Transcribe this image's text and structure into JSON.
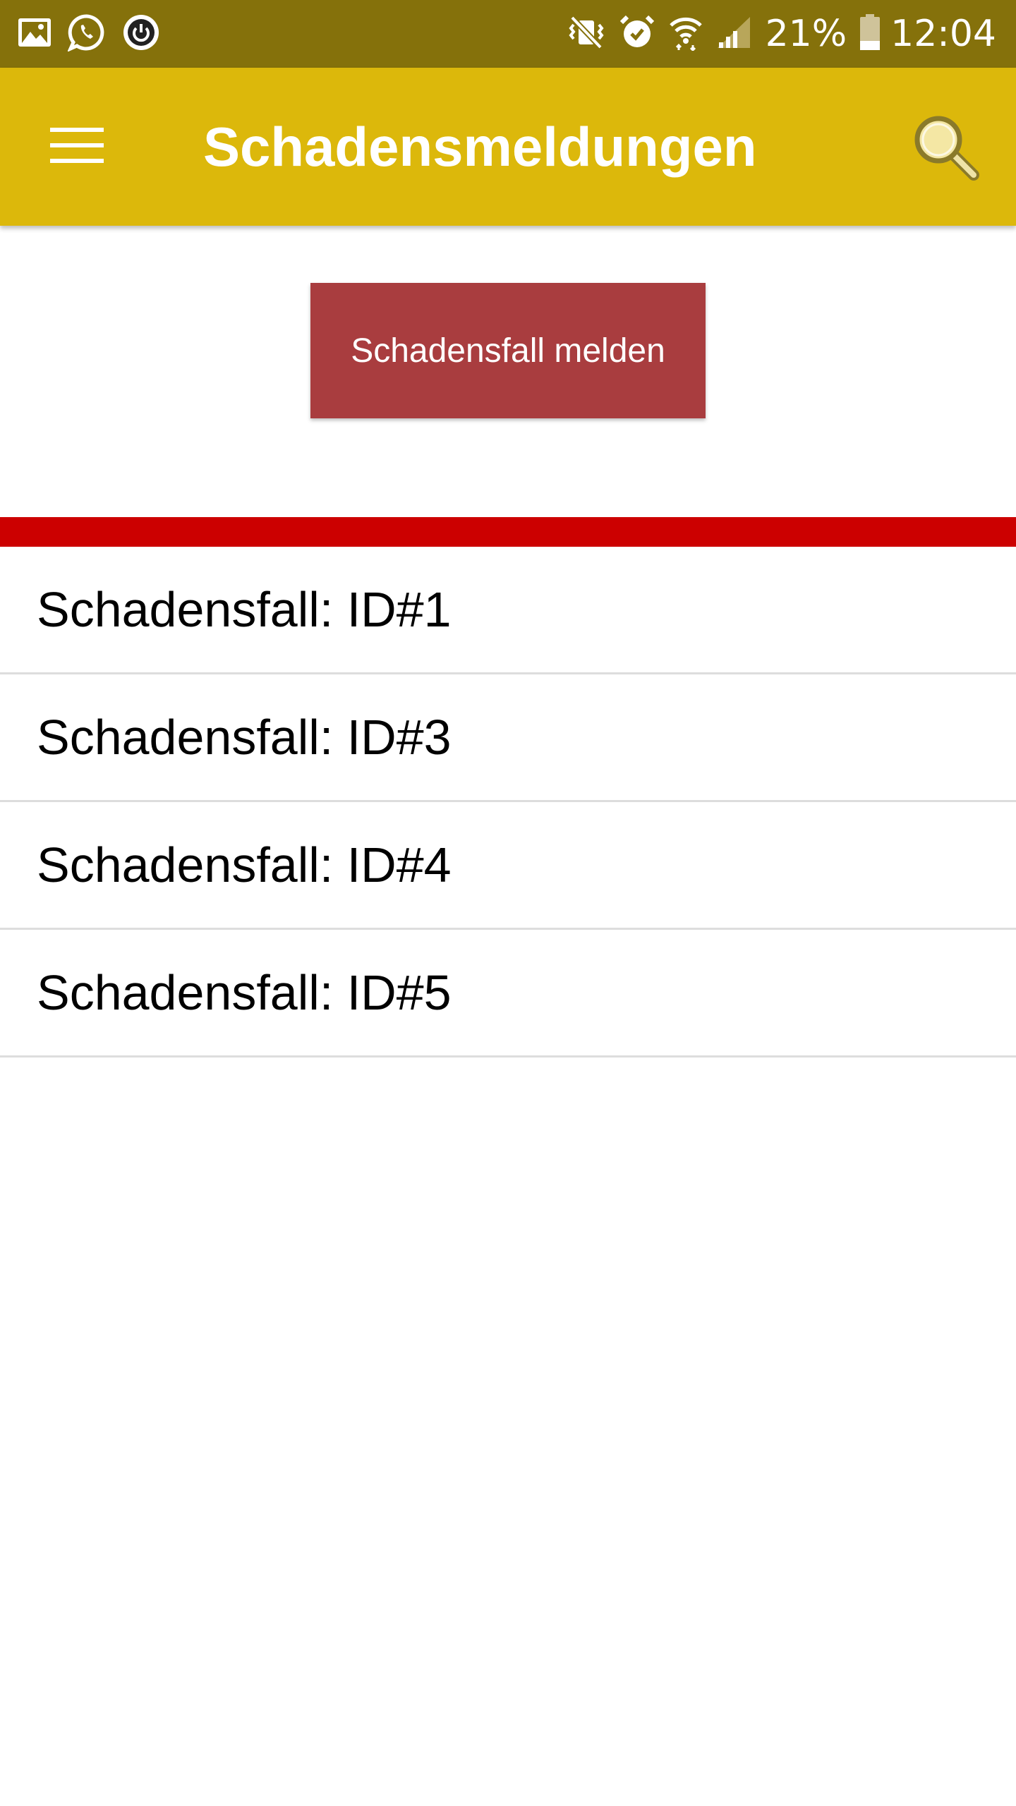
{
  "status_bar": {
    "left_icons": [
      "image-icon",
      "whatsapp-icon",
      "power-icon"
    ],
    "right_icons": [
      "mute-vibrate-icon",
      "alarm-icon",
      "wifi-icon",
      "signal-icon"
    ],
    "battery_percent": "21%",
    "time": "12:04"
  },
  "app_bar": {
    "title": "Schadensmeldungen",
    "menu_icon": "hamburger-menu-icon",
    "search_icon": "search-icon"
  },
  "actions": {
    "report_button_label": "Schadensfall melden"
  },
  "claims": [
    {
      "label": "Schadensfall: ID#1"
    },
    {
      "label": "Schadensfall: ID#3"
    },
    {
      "label": "Schadensfall: ID#4"
    },
    {
      "label": "Schadensfall: ID#5"
    }
  ],
  "colors": {
    "status_bar": "#85710b",
    "app_bar": "#dcb80b",
    "report_button": "#a93d3f",
    "divider": "#cc0000"
  }
}
